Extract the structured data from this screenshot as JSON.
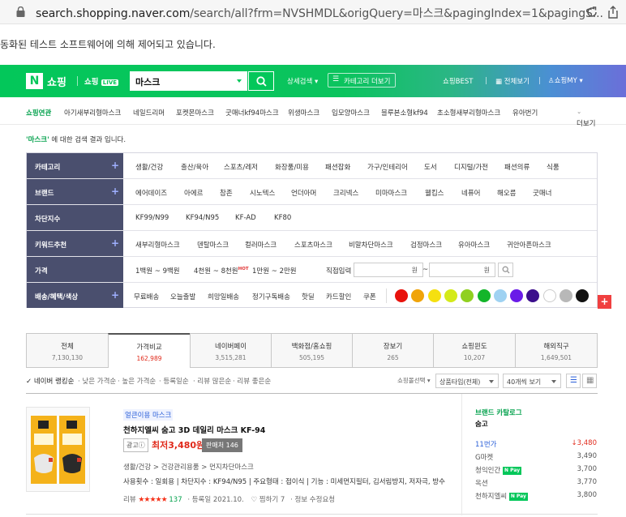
{
  "browser": {
    "url_host": "search.shopping.naver.com",
    "url_path": "/search/all?frm=NVSHMDL&origQuery=마스크&pagingIndex=1&pagingS...",
    "automation_message": "동화된 테스트 소프트웨어에 의해 제어되고 있습니다."
  },
  "header": {
    "logo": "N",
    "brand": "쇼핑",
    "live": "쇼핑",
    "live_badge": "LIVE",
    "query": "마스크",
    "detail_search": "상세검색",
    "category_more": "카테고리 더보기",
    "best": "쇼핑BEST",
    "all_view": "전체보기",
    "my": "쇼핑MY"
  },
  "related": {
    "label": "쇼핑연관",
    "items": [
      "아기새부리형마스크",
      "네일드리머",
      "포켓몬마스크",
      "굿매너kf94마스크",
      "위생마스크",
      "입모양마스크",
      "블루본소형kf94",
      "초소형새부리형마스크",
      "유아번기"
    ],
    "more": "더보기"
  },
  "result_msg": {
    "query": "'마스크'",
    "suffix": " 에 대한 검색 결과 입니다."
  },
  "filters": {
    "category": {
      "label": "카테고리",
      "items": [
        "생활/건강",
        "출산/육아",
        "스포츠/레저",
        "화장품/미용",
        "패션잡화",
        "가구/인테리어",
        "도서",
        "디지털/가전",
        "패션의류",
        "식품"
      ]
    },
    "brand": {
      "label": "브랜드",
      "items": [
        "에어데이즈",
        "아에르",
        "참존",
        "시노텍스",
        "언더아머",
        "크리넥스",
        "미마마스크",
        "웰킵스",
        "네퓨어",
        "해오름",
        "굿매너"
      ]
    },
    "block": {
      "label": "차단지수",
      "items": [
        "KF99/N99",
        "KF94/N95",
        "KF-AD",
        "KF80"
      ]
    },
    "keyword": {
      "label": "키워드추천",
      "items": [
        "새부리형마스크",
        "덴탈마스크",
        "컬러마스크",
        "스포츠마스크",
        "비말차단마스크",
        "검정마스크",
        "유아마스크",
        "귀안아픈마스크"
      ]
    },
    "price": {
      "label": "가격",
      "items": [
        "1백원 ~ 9백원",
        "4천원 ~ 8천원",
        "1만원 ~ 2만원"
      ],
      "hot": "HOT",
      "direct": "직접입력",
      "won": "원",
      "tilde": "~"
    },
    "benefit": {
      "label": "배송/혜택/색상",
      "items": [
        "무료배송",
        "오늘출발",
        "희망일배송",
        "정기구독배송",
        "핫딜",
        "카드할인",
        "쿠폰"
      ]
    },
    "colors": [
      "#e8120c",
      "#f0a40a",
      "#f5e010",
      "#d4ea1a",
      "#90d020",
      "#13b52a",
      "#9fd2f2",
      "#6a1be8",
      "#3b0e8c",
      "#ffffff",
      "#b8b8b8",
      "#111111"
    ],
    "plus": "+"
  },
  "tabs": [
    {
      "label": "전체",
      "count": "7,130,130"
    },
    {
      "label": "가격비교",
      "count": "162,989"
    },
    {
      "label": "네이버페이",
      "count": "3,515,281"
    },
    {
      "label": "백화점/홈쇼핑",
      "count": "505,195"
    },
    {
      "label": "장보기",
      "count": "265"
    },
    {
      "label": "쇼핑윈도",
      "count": "10,207"
    },
    {
      "label": "해외직구",
      "count": "1,649,501"
    }
  ],
  "sort": {
    "items": [
      "✓ 네이버 랭킹순",
      "· 낮은 가격순",
      "· 높은 가격순",
      "· 등록일순",
      "· 리뷰 많은순",
      "· 리뷰 좋은순"
    ],
    "seller": "쇼핑몰선택",
    "type": "상품타입(전체)",
    "per_page": "40개씩 보기"
  },
  "product": {
    "tag": "얼큰이용 마스크",
    "title": "천하지엘씨 숨고 3D 데일리 마스크 KF-94",
    "ad": "광고ⓘ",
    "price": "최저3,480원",
    "sellers": "판매처 146",
    "category": "생활/건강 > 건강관리용품 > 먼지차단마스크",
    "spec": "사용횟수 : 일회용 | 차단지수 : KF94/N95 | 주요형태 : 접이식 | 기능 : 미세먼지필터, 김서림방지, 저자극, 방수",
    "review_label": "리뷰",
    "stars": "★★★★★",
    "review_count": "137",
    "registered": "· 등록일 2021.10.",
    "zzim": "♡ 찜하기 7",
    "fix": "· 정보 수정요청"
  },
  "catalog": {
    "title": "브랜드 카탈로그",
    "brand": "숨고",
    "rows": [
      {
        "name": "11번가",
        "price": "↓3,480",
        "pay": ""
      },
      {
        "name": "G마켓",
        "price": "3,490",
        "pay": ""
      },
      {
        "name": "청익인간",
        "price": "3,700",
        "pay": "N Pay"
      },
      {
        "name": "옥션",
        "price": "3,770",
        "pay": ""
      },
      {
        "name": "천하지엘씨",
        "price": "3,800",
        "pay": "N Pay"
      }
    ]
  }
}
